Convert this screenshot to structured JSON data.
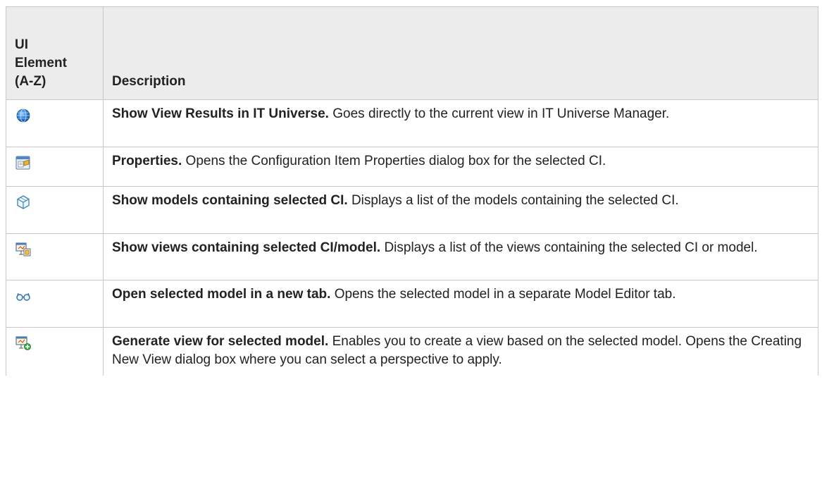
{
  "table": {
    "headers": {
      "ui_element_line1": "UI",
      "ui_element_line2": "Element",
      "ui_element_line3": "(A-Z)",
      "description": "Description"
    },
    "rows": [
      {
        "icon": "globe-icon",
        "title": "Show View Results in IT Universe.",
        "text": "Goes directly to the current view in IT Universe Manager."
      },
      {
        "icon": "properties-icon",
        "title": "Properties.",
        "text": "Opens the Configuration Item Properties dialog box for the selected CI."
      },
      {
        "icon": "model-cube-icon",
        "title": "Show models containing selected CI.",
        "text": "Displays a list of the models containing the selected CI."
      },
      {
        "icon": "views-containing-icon",
        "title": "Show views containing selected CI/model.",
        "text": "Displays a list of the views containing the selected CI or model."
      },
      {
        "icon": "glasses-icon",
        "title": "Open selected model in a new tab.",
        "text": "Opens the selected model in a separate Model Editor tab."
      },
      {
        "icon": "generate-view-icon",
        "title": "Generate view for selected model.",
        "text": "Enables you to create a view based on the selected model. Opens the Creating New View dialog box where you can select a perspective to apply."
      }
    ]
  }
}
